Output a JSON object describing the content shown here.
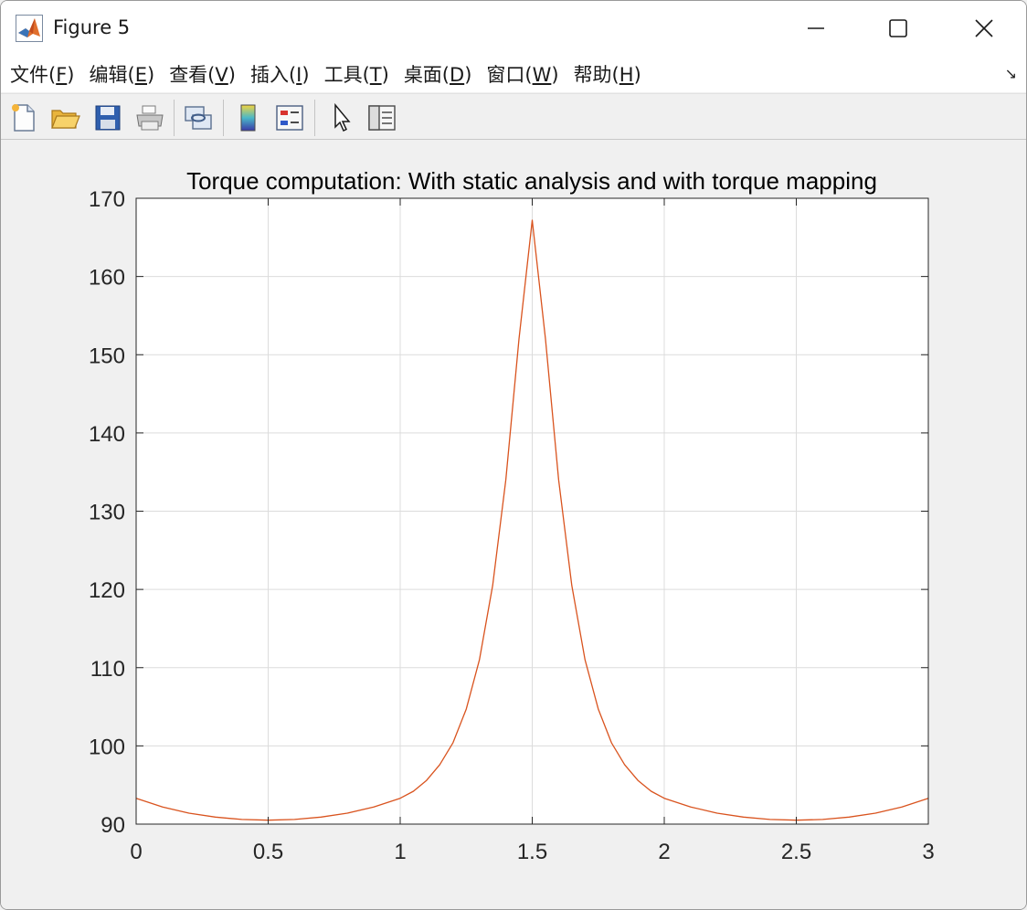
{
  "window": {
    "title": "Figure 5",
    "controls": {
      "minimize": "minimize",
      "maximize": "maximize",
      "close": "close"
    }
  },
  "menu": [
    {
      "label": "文件(",
      "key": "F",
      "tail": ")"
    },
    {
      "label": "编辑(",
      "key": "E",
      "tail": ")"
    },
    {
      "label": "查看(",
      "key": "V",
      "tail": ")"
    },
    {
      "label": "插入(",
      "key": "I",
      "tail": ")"
    },
    {
      "label": "工具(",
      "key": "T",
      "tail": ")"
    },
    {
      "label": "桌面(",
      "key": "D",
      "tail": ")"
    },
    {
      "label": "窗口(",
      "key": "W",
      "tail": ")"
    },
    {
      "label": "帮助(",
      "key": "H",
      "tail": ")"
    }
  ],
  "toolbar": {
    "icons": [
      "new-figure-icon",
      "open-file-icon",
      "save-icon",
      "print-icon",
      "link-plot-icon",
      "colorbar-icon",
      "legend-icon",
      "pointer-icon",
      "property-inspector-icon"
    ]
  },
  "colors": {
    "line": "#d9531e",
    "grid": "#dcdcdc",
    "axis": "#262626"
  },
  "chart_data": {
    "type": "line",
    "title": "Torque computation: With static analysis and with torque mapping",
    "xlabel": "",
    "ylabel": "",
    "xlim": [
      0,
      3
    ],
    "ylim": [
      90,
      170
    ],
    "xticks": [
      0,
      0.5,
      1,
      1.5,
      2,
      2.5,
      3
    ],
    "xtick_labels": [
      "0",
      "0.5",
      "1",
      "1.5",
      "2",
      "2.5",
      "3"
    ],
    "yticks": [
      90,
      100,
      110,
      120,
      130,
      140,
      150,
      160,
      170
    ],
    "ytick_labels": [
      "90",
      "100",
      "110",
      "120",
      "130",
      "140",
      "150",
      "160",
      "170"
    ],
    "grid": true,
    "series": [
      {
        "color": "#d9531e",
        "x": [
          0,
          0.1,
          0.2,
          0.3,
          0.4,
          0.5,
          0.6,
          0.7,
          0.8,
          0.9,
          1.0,
          1.05,
          1.1,
          1.15,
          1.2,
          1.25,
          1.3,
          1.35,
          1.4,
          1.45,
          1.5,
          1.55,
          1.6,
          1.65,
          1.7,
          1.75,
          1.8,
          1.85,
          1.9,
          1.95,
          2.0,
          2.1,
          2.2,
          2.3,
          2.4,
          2.5,
          2.6,
          2.7,
          2.8,
          2.9,
          3.0
        ],
        "y": [
          93.3,
          92.2,
          91.4,
          90.9,
          90.6,
          90.5,
          90.6,
          90.9,
          91.4,
          92.2,
          93.3,
          94.2,
          95.6,
          97.6,
          100.4,
          104.7,
          111.0,
          120.5,
          134.0,
          152.0,
          167.2,
          152.0,
          134.0,
          120.5,
          111.0,
          104.7,
          100.4,
          97.6,
          95.6,
          94.2,
          93.3,
          92.2,
          91.4,
          90.9,
          90.6,
          90.5,
          90.6,
          90.9,
          91.4,
          92.2,
          93.3
        ]
      }
    ]
  }
}
